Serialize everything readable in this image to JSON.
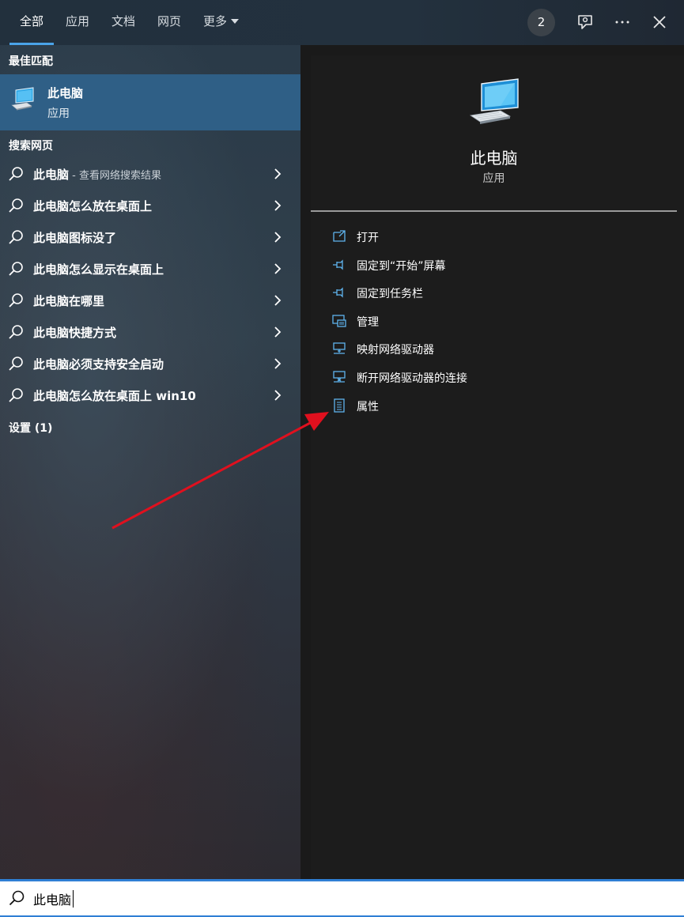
{
  "tabs": [
    {
      "label": "全部",
      "active": true
    },
    {
      "label": "应用",
      "active": false
    },
    {
      "label": "文档",
      "active": false
    },
    {
      "label": "网页",
      "active": false
    },
    {
      "label": "更多",
      "active": false
    }
  ],
  "header": {
    "badge_count": "2",
    "icons": [
      "feedback-icon",
      "more-icon",
      "close-icon"
    ]
  },
  "best_match": {
    "title": "最佳匹配",
    "name": "此电脑",
    "type": "应用",
    "icon": "computer-icon"
  },
  "web_search": {
    "title": "搜索网页",
    "items": [
      {
        "bold": "此电脑",
        "suffix": " - 查看网络搜索结果"
      },
      {
        "bold": "此电脑怎么放在桌面上",
        "suffix": ""
      },
      {
        "bold": "此电脑图标没了",
        "suffix": ""
      },
      {
        "bold": "此电脑怎么显示在桌面上",
        "suffix": ""
      },
      {
        "bold": "此电脑在哪里",
        "suffix": ""
      },
      {
        "bold": "此电脑快捷方式",
        "suffix": ""
      },
      {
        "bold": "此电脑必须支持安全启动",
        "suffix": ""
      },
      {
        "bold": "此电脑怎么放在桌面上 win10",
        "suffix": ""
      }
    ]
  },
  "settings": {
    "title": "设置 (1)"
  },
  "detail": {
    "name": "此电脑",
    "type": "应用",
    "actions": [
      {
        "label": "打开",
        "icon": "open-icon"
      },
      {
        "label": "固定到“开始”屏幕",
        "icon": "pin-icon"
      },
      {
        "label": "固定到任务栏",
        "icon": "pin-icon"
      },
      {
        "label": "管理",
        "icon": "manage-icon"
      },
      {
        "label": "映射网络驱动器",
        "icon": "network-drive-icon"
      },
      {
        "label": "断开网络驱动器的连接",
        "icon": "disconnect-drive-icon"
      },
      {
        "label": "属性",
        "icon": "properties-icon"
      }
    ]
  },
  "search": {
    "value": "此电脑"
  },
  "colors": {
    "accent": "#4aa3e8",
    "selected": "#2f5f86",
    "annotation": "#e0101e"
  }
}
